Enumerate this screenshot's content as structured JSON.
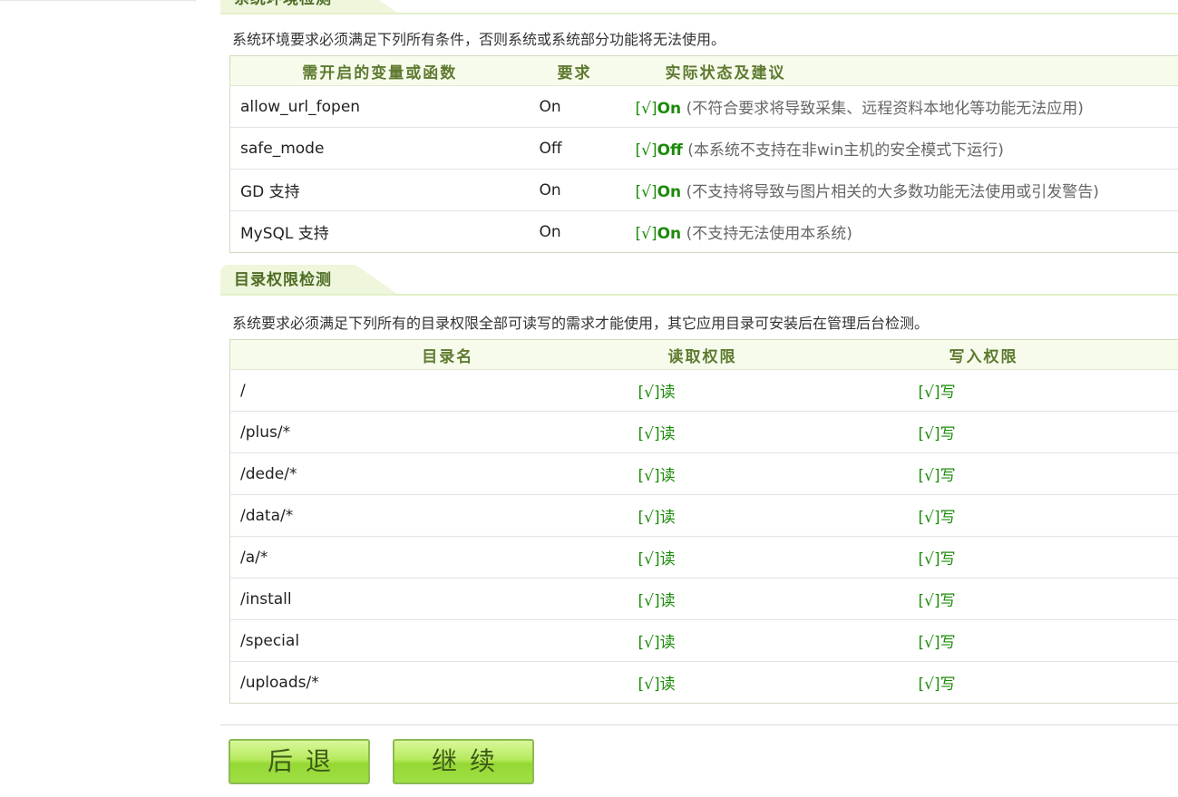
{
  "env_section": {
    "title": "系统环境检测",
    "description": "系统环境要求必须满足下列所有条件，否则系统或系统部分功能将无法使用。",
    "headers": {
      "name": "需开启的变量或函数",
      "required": "要求",
      "status": "实际状态及建议"
    },
    "rows": [
      {
        "name": "allow_url_fopen",
        "required": "On",
        "mark": "[√]",
        "value": "On",
        "note": "(不符合要求将导致采集、远程资料本地化等功能无法应用)"
      },
      {
        "name": "safe_mode",
        "required": "Off",
        "mark": "[√]",
        "value": "Off",
        "note": "(本系统不支持在非win主机的安全模式下运行)"
      },
      {
        "name": "GD 支持",
        "required": "On",
        "mark": "[√]",
        "value": "On",
        "note": "(不支持将导致与图片相关的大多数功能无法使用或引发警告)"
      },
      {
        "name": "MySQL 支持",
        "required": "On",
        "mark": "[√]",
        "value": "On",
        "note": "(不支持无法使用本系统)"
      }
    ]
  },
  "dir_section": {
    "title": "目录权限检测",
    "description": "系统要求必须满足下列所有的目录权限全部可读写的需求才能使用，其它应用目录可安装后在管理后台检测。",
    "headers": {
      "dir": "目录名",
      "read": "读取权限",
      "write": "写入权限"
    },
    "rows": [
      {
        "dir": "/",
        "read_mark": "[√]",
        "read": "读",
        "write_mark": "[√]",
        "write": "写"
      },
      {
        "dir": "/plus/*",
        "read_mark": "[√]",
        "read": "读",
        "write_mark": "[√]",
        "write": "写"
      },
      {
        "dir": "/dede/*",
        "read_mark": "[√]",
        "read": "读",
        "write_mark": "[√]",
        "write": "写"
      },
      {
        "dir": "/data/*",
        "read_mark": "[√]",
        "read": "读",
        "write_mark": "[√]",
        "write": "写"
      },
      {
        "dir": "/a/*",
        "read_mark": "[√]",
        "read": "读",
        "write_mark": "[√]",
        "write": "写"
      },
      {
        "dir": "/install",
        "read_mark": "[√]",
        "read": "读",
        "write_mark": "[√]",
        "write": "写"
      },
      {
        "dir": "/special",
        "read_mark": "[√]",
        "read": "读",
        "write_mark": "[√]",
        "write": "写"
      },
      {
        "dir": "/uploads/*",
        "read_mark": "[√]",
        "read": "读",
        "write_mark": "[√]",
        "write": "写"
      }
    ]
  },
  "buttons": {
    "back": "后退",
    "continue": "继续"
  }
}
